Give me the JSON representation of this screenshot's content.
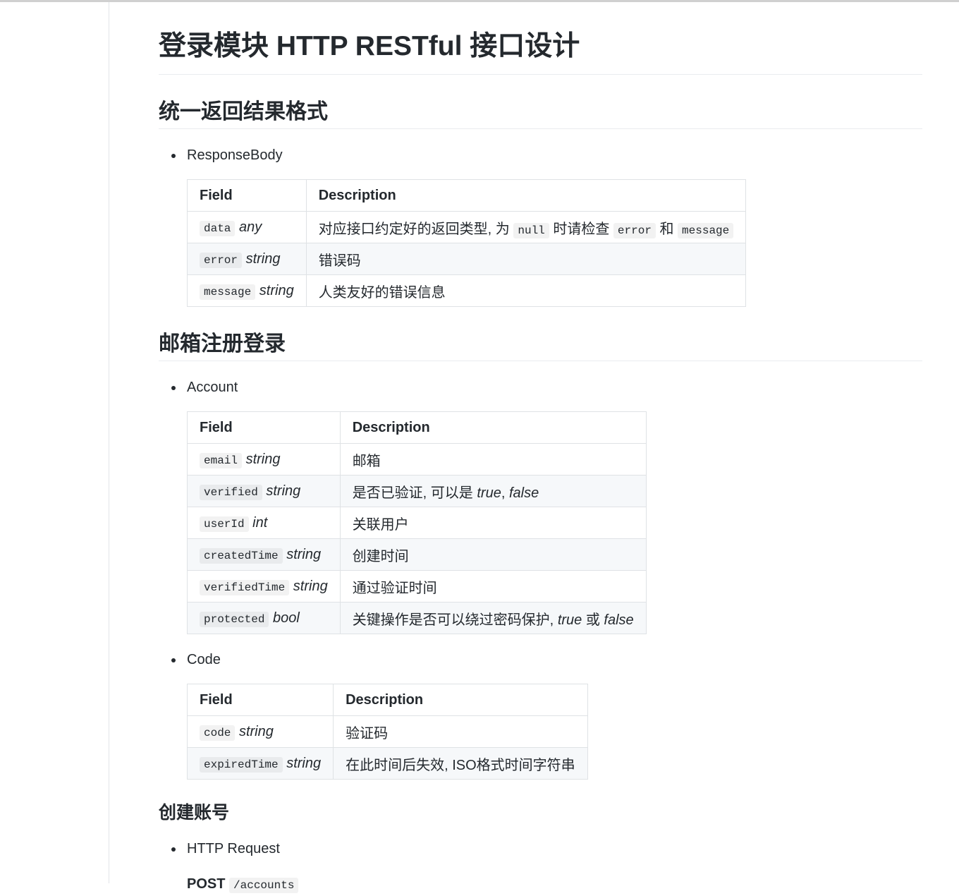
{
  "title": "登录模块 HTTP RESTful 接口设计",
  "section1": {
    "heading": "统一返回结果格式",
    "item": "ResponseBody",
    "headers": [
      "Field",
      "Description"
    ],
    "rows": [
      {
        "code": "data",
        "type": "any",
        "d1": "对应接口约定好的返回类型, 为",
        "c1": "null",
        "d2": "时请检查",
        "c2": "error",
        "d3": "和",
        "c3": "message"
      },
      {
        "code": "error",
        "type": "string",
        "desc": "错误码"
      },
      {
        "code": "message",
        "type": "string",
        "desc": "人类友好的错误信息"
      }
    ]
  },
  "section2": {
    "heading": "邮箱注册登录",
    "account": {
      "item": "Account",
      "headers": [
        "Field",
        "Description"
      ],
      "rows": [
        {
          "code": "email",
          "type": "string",
          "desc": "邮箱"
        },
        {
          "code": "verified",
          "type": "string",
          "desc": "是否已验证, 可以是",
          "v1": "true",
          "sep": ",",
          "v2": "false"
        },
        {
          "code": "userId",
          "type": "int",
          "desc": "关联用户"
        },
        {
          "code": "createdTime",
          "type": "string",
          "desc": "创建时间"
        },
        {
          "code": "verifiedTime",
          "type": "string",
          "desc": "通过验证时间"
        },
        {
          "code": "protected",
          "type": "bool",
          "desc": "关键操作是否可以绕过密码保护,",
          "v1": "true",
          "or": "或",
          "v2": "false"
        }
      ]
    },
    "code": {
      "item": "Code",
      "headers": [
        "Field",
        "Description"
      ],
      "rows": [
        {
          "code": "code",
          "type": "string",
          "desc": "验证码"
        },
        {
          "code": "expiredTime",
          "type": "string",
          "desc": "在此时间后失效, ISO格式时间字符串"
        }
      ]
    }
  },
  "section3": {
    "heading": "创建账号",
    "item": "HTTP Request",
    "method": "POST",
    "path": "/accounts"
  }
}
